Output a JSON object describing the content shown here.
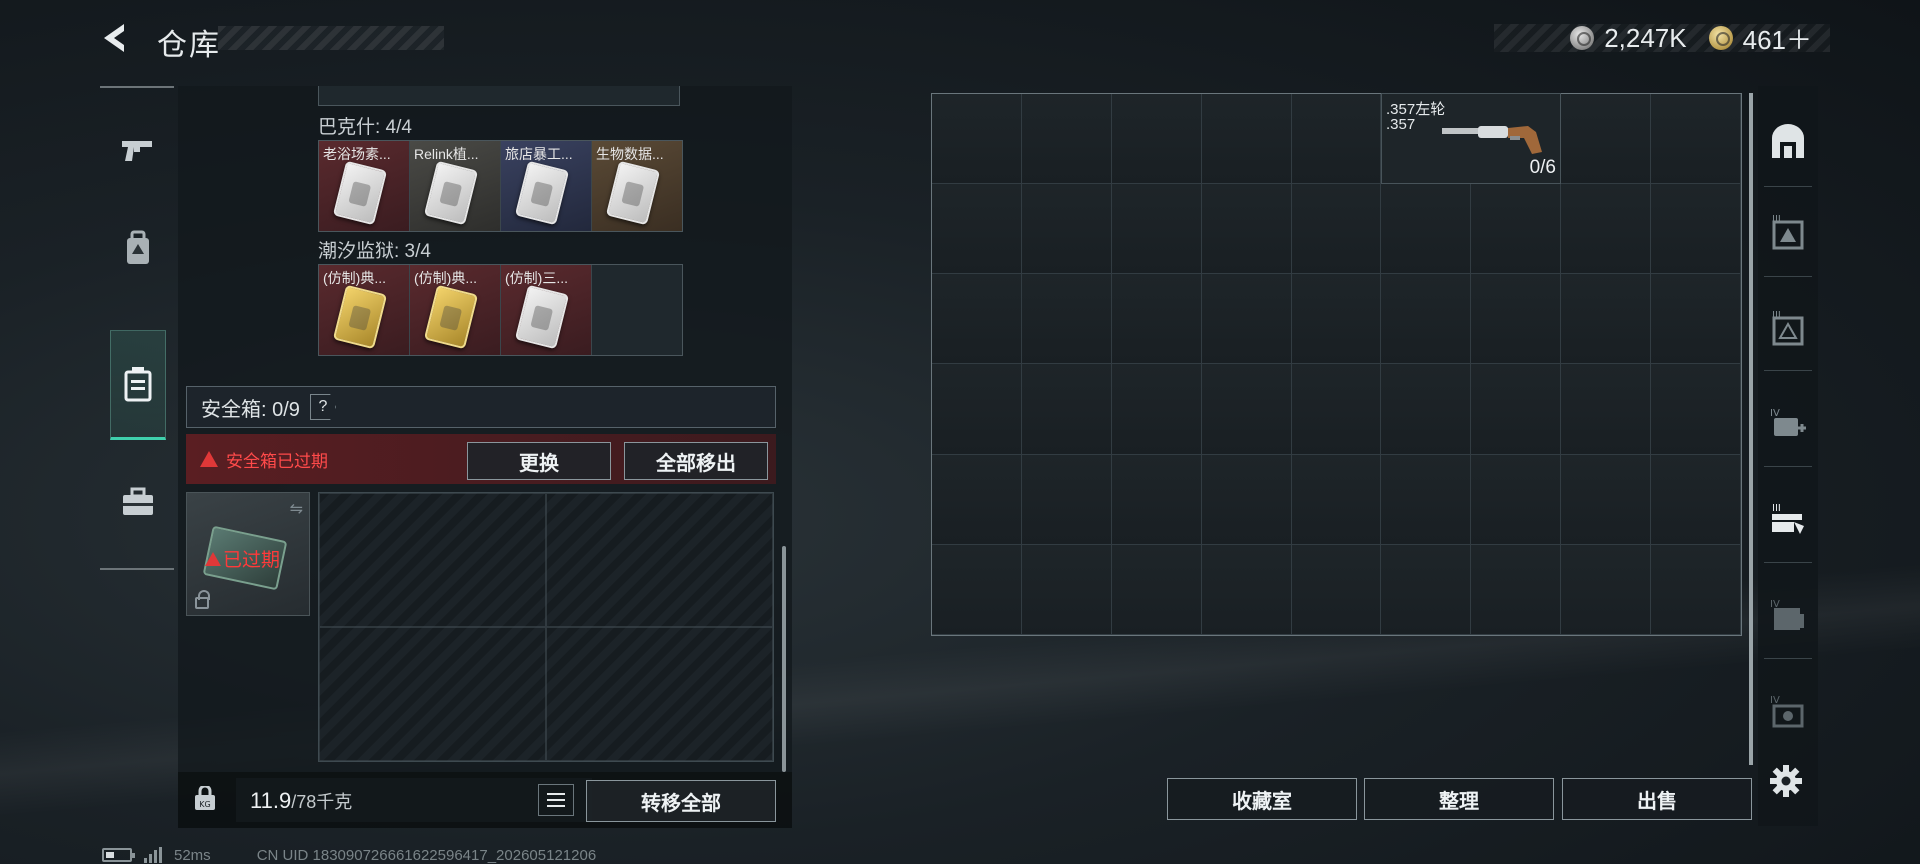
{
  "header": {
    "title": "仓库",
    "currency": [
      {
        "icon": "silver-coin-icon",
        "value": "2,247K"
      },
      {
        "icon": "gold-coin-icon",
        "value": "461＋"
      }
    ]
  },
  "left_nav": [
    "gun-icon",
    "backpack-icon",
    "safebox-icon",
    "toolbox-icon"
  ],
  "inventory": {
    "groups": [
      {
        "label": "巴克什: 4/4",
        "items": [
          {
            "name": "老浴场素...",
            "color": "red"
          },
          {
            "name": "Relink植...",
            "color": "gray"
          },
          {
            "name": "旅店暴工...",
            "color": "blue"
          },
          {
            "name": "生物数据...",
            "color": "brown"
          }
        ]
      },
      {
        "label": "潮汐监狱: 3/4",
        "items": [
          {
            "name": "(仿制)典...",
            "color": "red"
          },
          {
            "name": "(仿制)典...",
            "color": "red"
          },
          {
            "name": "(仿制)三...",
            "color": "red"
          },
          {
            "name": "",
            "color": "empty"
          }
        ]
      }
    ],
    "safe": {
      "label": "安全箱: 0/9",
      "help": "?",
      "expired_notice": "安全箱已过期",
      "replace_label": "更换",
      "remove_all_label": "全部移出",
      "case_status": "已过期"
    },
    "footer": {
      "weight_current": "11.9",
      "weight_max": "/78千克",
      "transfer_all_label": "转移全部"
    }
  },
  "stash": {
    "columns": 9,
    "rows": 6,
    "item": {
      "line1": ".357左轮",
      "line2": ".357",
      "ammo": "0/6"
    },
    "buttons": {
      "collection": "收藏室",
      "sort": "整理",
      "sell": "出售"
    }
  },
  "right_nav": [
    "stash-icon",
    "container-1-icon",
    "container-2-icon",
    "medkit-icon",
    "weapon-rack-icon",
    "container-3-icon",
    "container-4-icon"
  ],
  "status_bar": {
    "ping": "52ms",
    "uid": "CN UID 1830907266616225964​17_202605121206"
  },
  "colors": {
    "accent": "#3fd1ad",
    "warning": "#ff4a4a",
    "panel": "#1b2226"
  }
}
